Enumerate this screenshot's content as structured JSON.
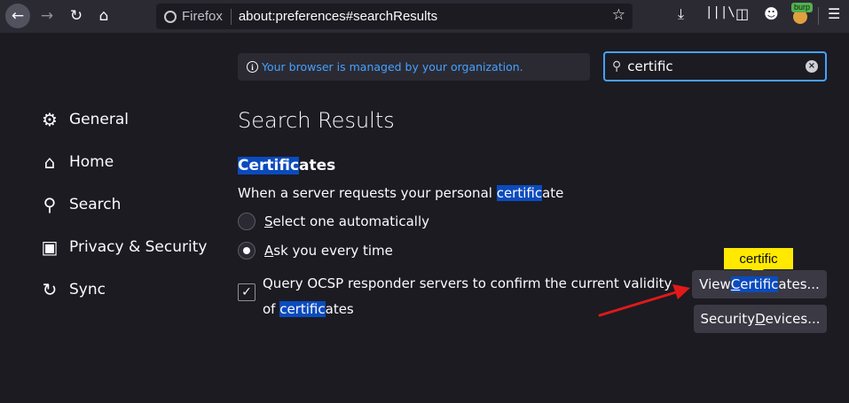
{
  "toolbar": {
    "identity_label": "Firefox",
    "url": "about:preferences#searchResults",
    "burp_badge": "burp"
  },
  "managed_notice": "Your browser is managed by your organization.",
  "search": {
    "value": "certific"
  },
  "sidebar": {
    "items": [
      {
        "label": "General",
        "icon": "gear-icon"
      },
      {
        "label": "Home",
        "icon": "home-icon"
      },
      {
        "label": "Search",
        "icon": "search-icon"
      },
      {
        "label": "Privacy & Security",
        "icon": "lock-icon"
      },
      {
        "label": "Sync",
        "icon": "sync-icon"
      }
    ]
  },
  "main": {
    "title": "Search Results",
    "section": {
      "title_hl": "Certific",
      "title_rest": "ates"
    },
    "description": {
      "before": "When a server requests your personal ",
      "hl": "certific",
      "after": "ate"
    },
    "radios": [
      {
        "accesskey": "S",
        "rest": "elect one automatically",
        "checked": false
      },
      {
        "accesskey": "A",
        "rest": "sk you every time",
        "checked": true
      }
    ],
    "ocsp": {
      "before": "Query OCSP responder servers to confirm the current validity of ",
      "hl": "certific",
      "after": "ates",
      "checked": true
    },
    "buttons": {
      "view": {
        "before": "View ",
        "hl": "C",
        "hl_rest": "ertific",
        "after": "ates..."
      },
      "security": {
        "before": "Security ",
        "accesskey": "D",
        "after": "evices..."
      }
    },
    "tooltip": "certific"
  },
  "colors": {
    "accent": "#45a1ff",
    "highlight": "#0a4bbd",
    "tooltip": "#ffe900",
    "annotation_arrow": "#e0191a"
  }
}
